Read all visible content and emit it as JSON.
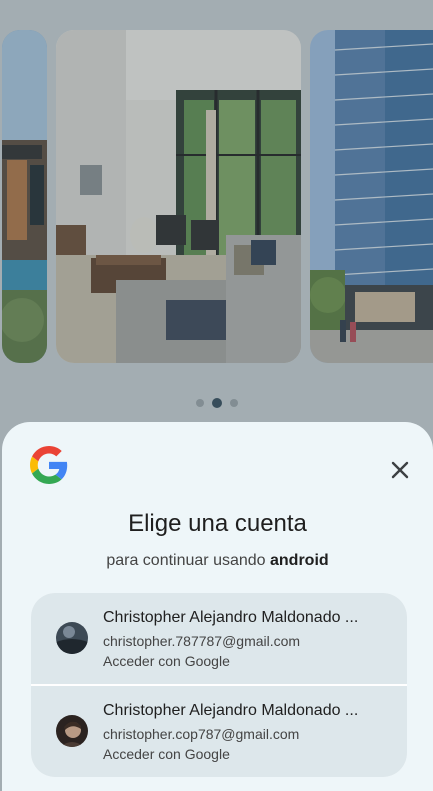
{
  "carousel": {
    "slides": [
      "house-exterior-image",
      "living-room-image",
      "apartment-tower-image"
    ],
    "active_index": 1,
    "page_count": 3
  },
  "sheet": {
    "title": "Elige una cuenta",
    "subtitle_prefix": "para continuar usando ",
    "subtitle_app": "android",
    "close_icon": "close-icon",
    "brand_icon": "google-logo"
  },
  "accounts": [
    {
      "name": "Christopher Alejandro Maldonado ...",
      "email": "christopher.787787@gmail.com",
      "action": "Acceder con Google"
    },
    {
      "name": "Christopher Alejandro Maldonado ...",
      "email": "christopher.cop787@gmail.com",
      "action": "Acceder con Google"
    }
  ],
  "colors": {
    "sheet_bg": "#eef6f9",
    "account_bg": "#dde7eb",
    "scrim": "#46555f"
  }
}
